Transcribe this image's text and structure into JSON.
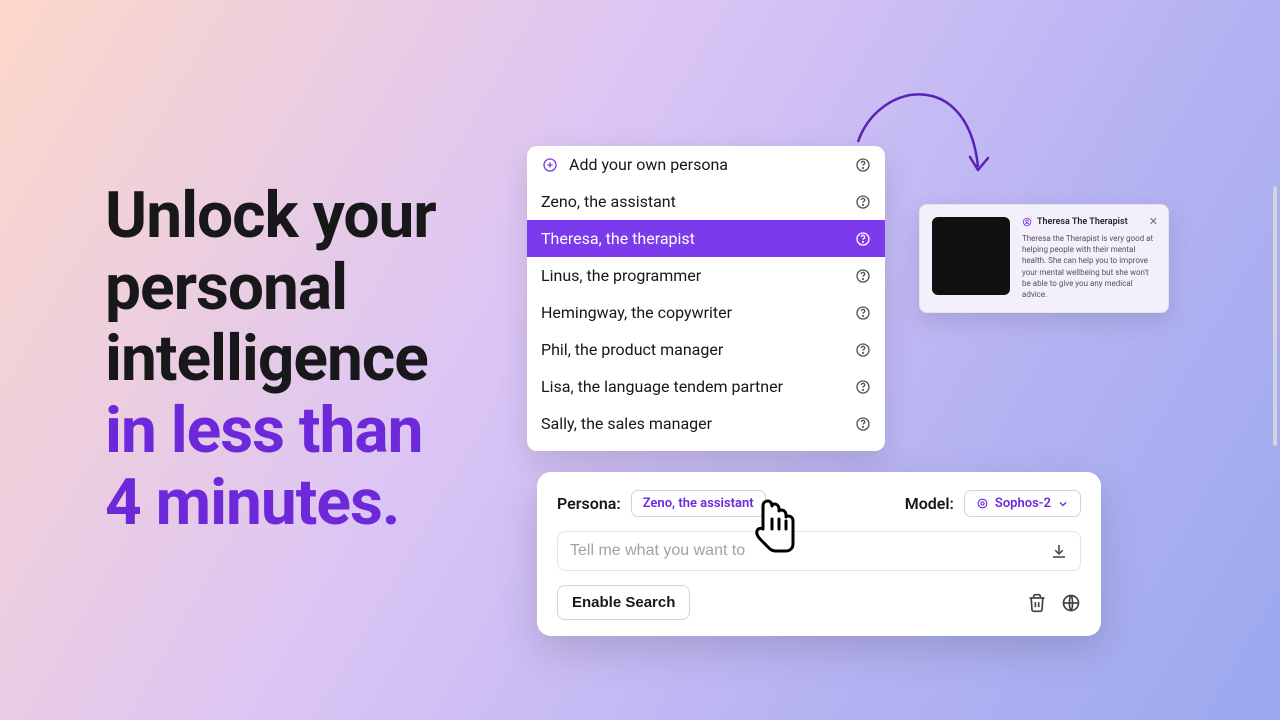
{
  "headline": {
    "line1": "Unlock your",
    "line2": "personal",
    "line3": "intelligence",
    "line4": "in less than",
    "line5": "4 minutes."
  },
  "colors": {
    "accent": "#6d28d9",
    "selected_bg": "#7c3aed"
  },
  "persona_list": {
    "add_label": "Add your own persona",
    "items": [
      {
        "label": "Zeno, the assistant",
        "selected": false
      },
      {
        "label": "Theresa, the therapist",
        "selected": true
      },
      {
        "label": "Linus, the programmer",
        "selected": false
      },
      {
        "label": "Hemingway, the copywriter",
        "selected": false
      },
      {
        "label": "Phil, the product manager",
        "selected": false
      },
      {
        "label": "Lisa, the language tendem partner",
        "selected": false
      },
      {
        "label": "Sally, the sales manager",
        "selected": false
      }
    ]
  },
  "detail_card": {
    "title": "Theresa The Therapist",
    "description": "Theresa the Therapist is very good at helping people with their mental health. She can help you to improve your mental wellbeing but she won't be able to give you any medical advice."
  },
  "prompt_box": {
    "persona_label": "Persona:",
    "persona_value": "Zeno, the assistant",
    "model_label": "Model:",
    "model_value": "Sophos-2",
    "input_placeholder": "Tell me what you want to",
    "enable_search": "Enable Search"
  }
}
